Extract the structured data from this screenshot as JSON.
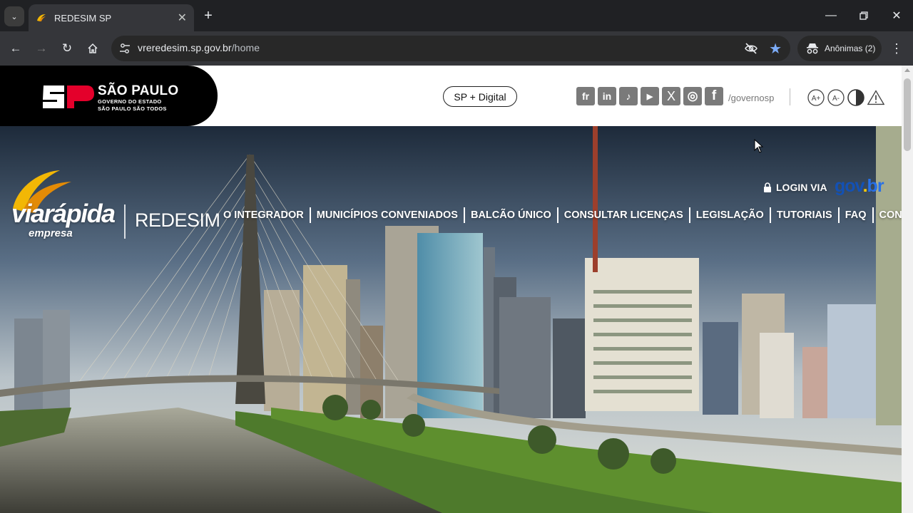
{
  "browser": {
    "tab_title": "REDESIM SP",
    "url_host": "vreredesim.sp.gov.br",
    "url_path": "/home",
    "incognito_label": "Anônimas (2)"
  },
  "gov_header": {
    "state_title": "SÃO PAULO",
    "state_sub1": "GOVERNO DO ESTADO",
    "state_sub2": "SÃO PAULO SÃO TODOS",
    "sp_digital": "SP + Digital",
    "socials": [
      {
        "name": "flickr",
        "glyph": "fr"
      },
      {
        "name": "linkedin",
        "glyph": "in"
      },
      {
        "name": "tiktok",
        "glyph": "♪"
      },
      {
        "name": "youtube",
        "glyph": "▶"
      },
      {
        "name": "x",
        "glyph": "X"
      },
      {
        "name": "instagram",
        "glyph": "◎"
      },
      {
        "name": "facebook",
        "glyph": "f"
      }
    ],
    "handle": "/governosp",
    "a11y": {
      "increase": "A+",
      "decrease": "A-"
    }
  },
  "hero": {
    "brand_main": "viarápida",
    "brand_sub": "empresa",
    "product": "REDESIM",
    "login_label": "LOGIN VIA",
    "govbr": {
      "g": "gov",
      "dot": ".",
      "br": "br"
    },
    "nav": [
      "O INTEGRADOR",
      "MUNICÍPIOS CONVENIADOS",
      "BALCÃO ÚNICO",
      "CONSULTAR LICENÇAS",
      "LEGISLAÇÃO",
      "TUTORIAIS",
      "FAQ",
      "CONTATO"
    ]
  },
  "colors": {
    "chrome_bg": "#202124",
    "toolbar_bg": "#35363a",
    "govbr_blue": "#1351b4",
    "govbr_yellow": "#ffcd07",
    "sp_red": "#e4002b"
  }
}
